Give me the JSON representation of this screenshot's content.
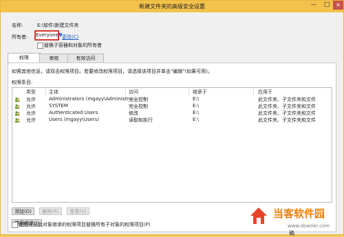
{
  "window": {
    "title": "新建文件夹的高级安全设置",
    "minimize_glyph": "—",
    "maximize_glyph": "□",
    "close_glyph": "✕"
  },
  "fields": {
    "name_label": "名称:",
    "name_value": "E:\\软件\\新建文件夹",
    "owner_label": "所有者:",
    "owner_value": "Everyone",
    "change_link": "更改(C)",
    "replace_owner_label": "替换子容器和对象的所有者"
  },
  "tabs": [
    {
      "label": "权限",
      "active": true
    },
    {
      "label": "审核",
      "active": false
    },
    {
      "label": "有效访问",
      "active": false
    }
  ],
  "panel": {
    "info_line": "如需其他信息，请双击权限项目。若要修改权限项目，请选择该项目并单击\"编辑\"(如果可用)。",
    "entries_label": "权限条目:"
  },
  "table": {
    "headers": [
      "类型",
      "主体",
      "访问",
      "继承于",
      "应用于"
    ],
    "rows": [
      {
        "type": "允许",
        "principal": "Administrators (mgayy\\Administr...",
        "access": "完全控制",
        "inherited": "E:\\",
        "applies": "此文件夹、子文件夹和文件"
      },
      {
        "type": "允许",
        "principal": "SYSTEM",
        "access": "完全控制",
        "inherited": "E:\\",
        "applies": "此文件夹、子文件夹和文件"
      },
      {
        "type": "允许",
        "principal": "Authenticated Users",
        "access": "修改",
        "inherited": "E:\\",
        "applies": "此文件夹、子文件夹和文件"
      },
      {
        "type": "允许",
        "principal": "Users (mgayy\\Users)",
        "access": "读取和执行",
        "inherited": "E:\\",
        "applies": "此文件夹、子文件夹和文件"
      }
    ]
  },
  "buttons": {
    "add": "添加(D)",
    "remove": "删除(R)",
    "view": "查看(V)",
    "disable_inheritance": "禁用继承(I)"
  },
  "bottom": {
    "replace_child_label": "使用可从此对象继承的权限项目替换所有子对象的权限项目(P)"
  },
  "watermark": {
    "brand_text": "当客软件园",
    "url": "www.downkr.com",
    "fragment": "确"
  },
  "colors": {
    "title_bar": "#f2c24b",
    "owner_highlight": "#d23a30",
    "link": "#1b5fc1",
    "close_button": "#c7504b"
  }
}
